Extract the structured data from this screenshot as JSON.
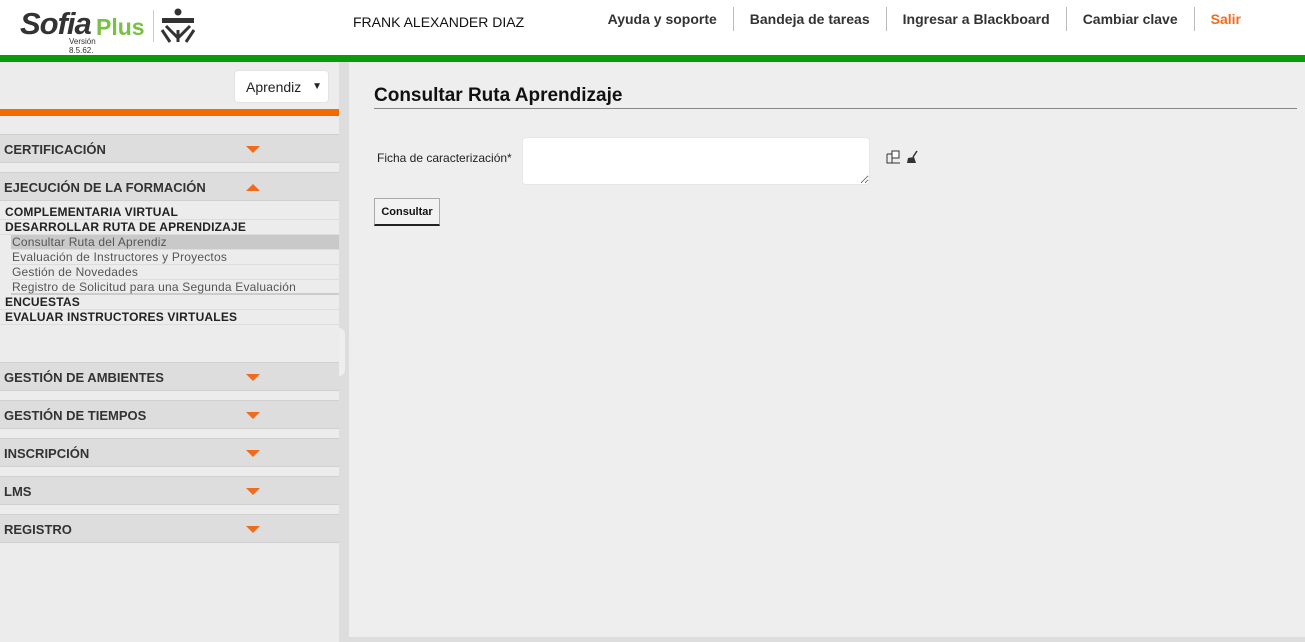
{
  "header": {
    "logo_text": "Sofia",
    "logo_plus": "Plus",
    "version": "Versión 8.5.62.",
    "sena_logo": "SENA",
    "user_name": "FRANK ALEXANDER DIAZ",
    "nav": [
      "Ayuda y soporte",
      "Bandeja de tareas",
      "Ingresar a Blackboard",
      "Cambiar clave",
      "Salir"
    ]
  },
  "sidebar": {
    "role": "Aprendiz",
    "sections": {
      "certificacion": "CERTIFICACIÓN",
      "ejecucion": "EJECUCIÓN DE LA FORMACIÓN",
      "ambientes": "GESTIÓN DE AMBIENTES",
      "tiempos": "GESTIÓN DE TIEMPOS",
      "inscripcion": "INSCRIPCIÓN",
      "lms": "LMS",
      "registro": "REGISTRO"
    },
    "submenu": [
      "COMPLEMENTARIA VIRTUAL",
      "DESARROLLAR RUTA DE APRENDIZAJE",
      "Consultar Ruta del Aprendiz",
      "Evaluación de Instructores y Proyectos",
      "Gestión de Novedades",
      "Registro de Solicitud para una Segunda Evaluación",
      "ENCUESTAS",
      "EVALUAR INSTRUCTORES VIRTUALES"
    ]
  },
  "main": {
    "title": "Consultar Ruta Aprendizaje",
    "field_label": "Ficha de caracterización*",
    "field_value": "",
    "button": "Consultar"
  },
  "colors": {
    "green": "#0a9a0a",
    "orange": "#f26a00",
    "salir": "#f26a1b"
  }
}
